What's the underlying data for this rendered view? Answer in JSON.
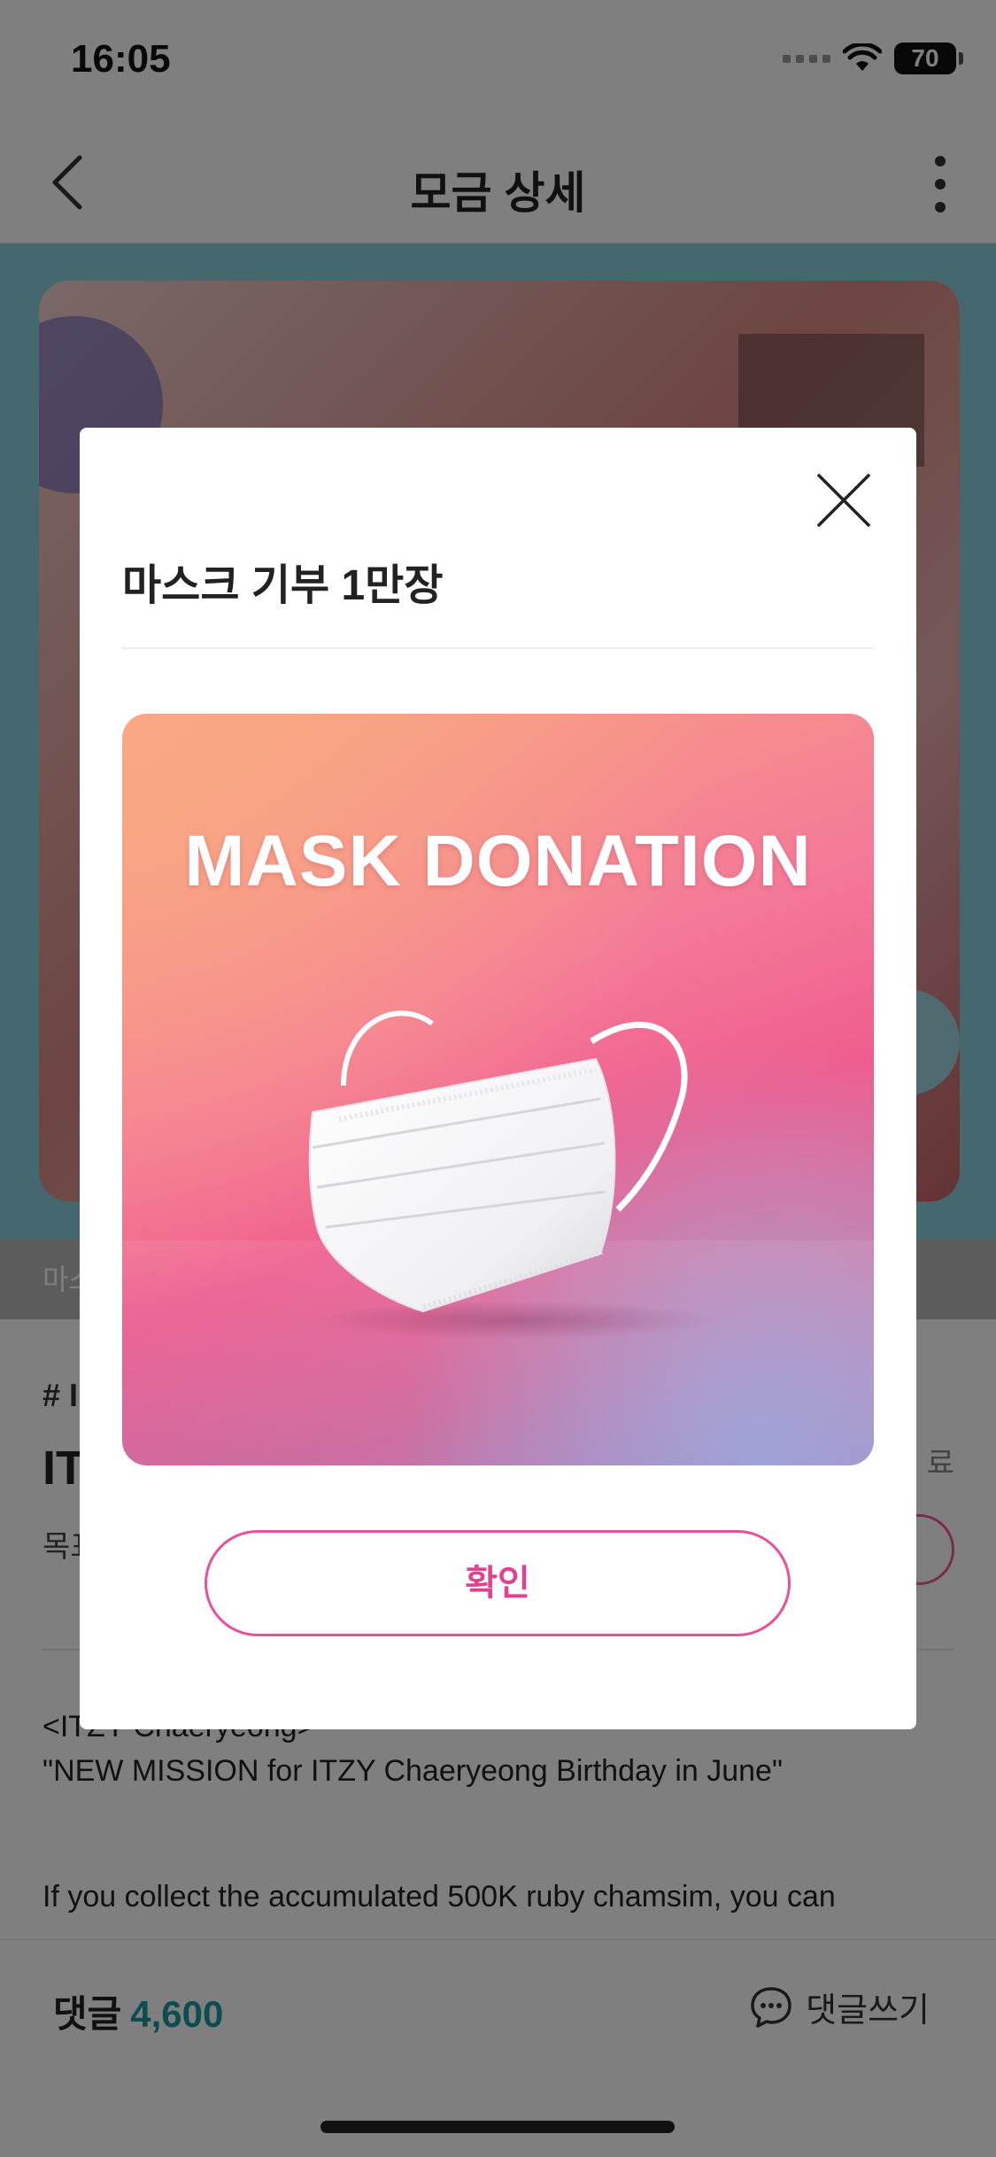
{
  "status_bar": {
    "time": "16:05",
    "battery": "70"
  },
  "nav": {
    "title": "모금 상세"
  },
  "hero": {
    "subtitle_partial": "마스"
  },
  "info": {
    "tag_partial": "# I",
    "title_partial": "IT",
    "status_partial": "료",
    "goal_partial": "목표"
  },
  "description": {
    "line1": "<ITZY Chaeryeong>",
    "line2": " \"NEW MISSION for ITZY Chaeryeong Birthday in June\"",
    "line3": "If you collect the accumulated 500K ruby chamsim, you can"
  },
  "bottom": {
    "comment_label": "댓글",
    "comment_count": "4,600",
    "write_label": "댓글쓰기"
  },
  "modal": {
    "title": "마스크 기부 1만장",
    "image_text": "MASK DONATION",
    "confirm_label": "확인"
  },
  "colors": {
    "accent": "#EA4F9A",
    "teal": "#1A9AA5",
    "hero_bg": "#8AD0DC"
  }
}
